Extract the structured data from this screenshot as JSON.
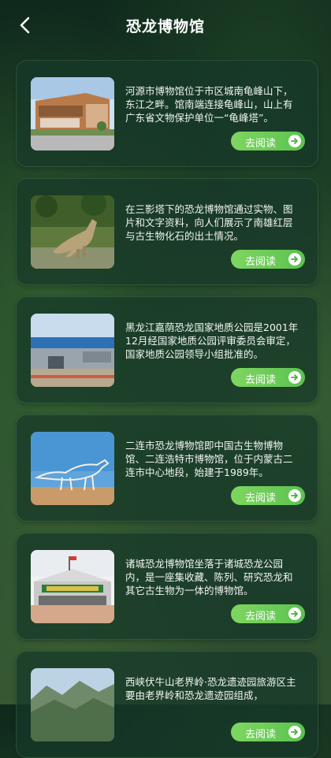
{
  "header": {
    "title": "恐龙博物馆"
  },
  "cards": [
    {
      "text": "河源市博物馆位于市区城南龟峰山下，东江之畔。馆南端连接龟峰山，山上有广东省文物保护单位一“龟峰塔”。",
      "button": "去阅读",
      "image_icon": "museum-building"
    },
    {
      "text": "在三影塔下的恐龙博物馆通过实物、图片和文字资料，向人们展示了南雄红层与古生物化石的出土情况。",
      "button": "去阅读",
      "image_icon": "dinosaur-statue"
    },
    {
      "text": "黑龙江嘉荫恐龙国家地质公园是2001年12月经国家地质公园评审委员会审定，国家地质公园领导小组批准的。",
      "button": "去阅读",
      "image_icon": "park-building"
    },
    {
      "text": "二连市恐龙博物馆即中国古生物博物馆、二连浩特市博物馆，位于内蒙古二连市中心地段，始建于1989年。",
      "button": "去阅读",
      "image_icon": "dinosaur-skeleton"
    },
    {
      "text": "诸城恐龙博物馆坐落于诸城恐龙公园内，是一座集收藏、陈列、研究恐龙和其它古生物为一体的博物馆。",
      "button": "去阅读",
      "image_icon": "museum-facade"
    },
    {
      "text": "西峡伏牛山老界岭·恐龙遗迹园旅游区主要由老界岭和恐龙遗迹园组成，",
      "button": "去阅读",
      "image_icon": "mountain-landscape"
    }
  ]
}
